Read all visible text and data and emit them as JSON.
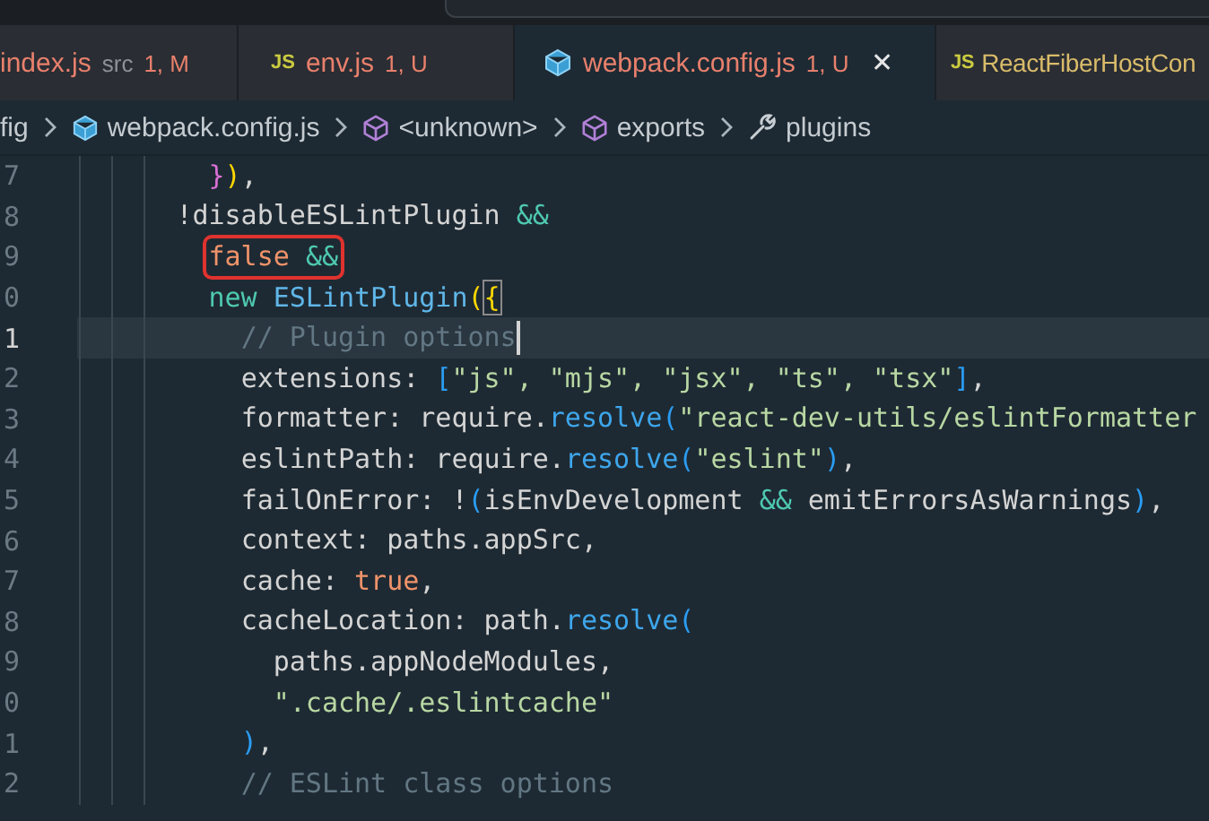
{
  "tabs": [
    {
      "label": "index.js",
      "description": "src",
      "status": "1, M",
      "kind": "plain",
      "color": "#e8806c",
      "selected": false
    },
    {
      "label": "env.js",
      "status": "1, U",
      "kind": "js",
      "icon_text": "JS",
      "color": "#e8806c",
      "selected": false
    },
    {
      "label": "webpack.config.js",
      "status": "1, U",
      "kind": "cube",
      "color": "#e8806c",
      "selected": true,
      "close": "✕"
    },
    {
      "label": "ReactFiberHostCon",
      "kind": "js",
      "icon_text": "JS",
      "color": "#d9bb6a",
      "selected": false
    }
  ],
  "breadcrumbs": [
    {
      "label": "fig",
      "kind": "folder"
    },
    {
      "label": "webpack.config.js",
      "kind": "file"
    },
    {
      "label": "<unknown>",
      "kind": "symbol"
    },
    {
      "label": "exports",
      "kind": "symbol"
    },
    {
      "label": "plugins",
      "kind": "property"
    }
  ],
  "lines": [
    {
      "number": "7",
      "current": false,
      "boxed": false,
      "tokens": [
        {
          "text": "        }",
          "kind": "bracket2"
        },
        {
          "text": ")",
          "kind": "bracket1"
        },
        {
          "text": ",",
          "kind": "plain"
        }
      ]
    },
    {
      "number": "8",
      "current": false,
      "boxed": false,
      "tokens": [
        {
          "text": "      !disableESLintPlugin ",
          "kind": "plain"
        },
        {
          "text": "&&",
          "kind": "operator"
        }
      ]
    },
    {
      "number": "9",
      "current": false,
      "boxed": true,
      "tokens": [
        {
          "text": "        false ",
          "kind": "constant"
        },
        {
          "text": "&&",
          "kind": "operator"
        }
      ]
    },
    {
      "number": "0",
      "current": false,
      "boxed": false,
      "tokens": [
        {
          "text": "        new ",
          "kind": "operator"
        },
        {
          "text": "ESLintPlugin",
          "kind": "class"
        },
        {
          "text": "(",
          "kind": "bracket1"
        },
        {
          "text": "{",
          "kind": "bracket-match"
        }
      ]
    },
    {
      "number": "1",
      "current": true,
      "boxed": false,
      "tokens": [
        {
          "text": "          // Plugin options",
          "kind": "comment"
        }
      ]
    },
    {
      "number": "2",
      "current": false,
      "boxed": false,
      "tokens": [
        {
          "text": "          extensions: ",
          "kind": "plain"
        },
        {
          "text": "[",
          "kind": "bracket3"
        },
        {
          "text": "\"js\", \"mjs\", \"jsx\", \"ts\", \"tsx\"",
          "kind": "string"
        },
        {
          "text": "]",
          "kind": "bracket3"
        },
        {
          "text": ",",
          "kind": "plain"
        }
      ]
    },
    {
      "number": "3",
      "current": false,
      "boxed": false,
      "tokens": [
        {
          "text": "          formatter: require.",
          "kind": "plain"
        },
        {
          "text": "resolve",
          "kind": "function"
        },
        {
          "text": "(",
          "kind": "bracket3"
        },
        {
          "text": "\"react-dev-utils/eslintFormatter",
          "kind": "string"
        }
      ]
    },
    {
      "number": "4",
      "current": false,
      "boxed": false,
      "tokens": [
        {
          "text": "          eslintPath: require.",
          "kind": "plain"
        },
        {
          "text": "resolve",
          "kind": "function"
        },
        {
          "text": "(",
          "kind": "bracket3"
        },
        {
          "text": "\"eslint\"",
          "kind": "string"
        },
        {
          "text": ")",
          "kind": "bracket3"
        },
        {
          "text": ",",
          "kind": "plain"
        }
      ]
    },
    {
      "number": "5",
      "current": false,
      "boxed": false,
      "tokens": [
        {
          "text": "          failOnError: !",
          "kind": "plain"
        },
        {
          "text": "(",
          "kind": "bracket3"
        },
        {
          "text": "isEnvDevelopment ",
          "kind": "plain"
        },
        {
          "text": "&&",
          "kind": "operator"
        },
        {
          "text": " emitErrorsAsWarnings",
          "kind": "plain"
        },
        {
          "text": ")",
          "kind": "bracket3"
        },
        {
          "text": ",",
          "kind": "plain"
        }
      ]
    },
    {
      "number": "6",
      "current": false,
      "boxed": false,
      "tokens": [
        {
          "text": "          context: paths.appSrc,",
          "kind": "plain"
        }
      ]
    },
    {
      "number": "7",
      "current": false,
      "boxed": false,
      "tokens": [
        {
          "text": "          cache: ",
          "kind": "plain"
        },
        {
          "text": "true",
          "kind": "constant"
        },
        {
          "text": ",",
          "kind": "plain"
        }
      ]
    },
    {
      "number": "8",
      "current": false,
      "boxed": false,
      "tokens": [
        {
          "text": "          cacheLocation: path.",
          "kind": "plain"
        },
        {
          "text": "resolve",
          "kind": "function"
        },
        {
          "text": "(",
          "kind": "bracket3"
        }
      ]
    },
    {
      "number": "9",
      "current": false,
      "boxed": false,
      "tokens": [
        {
          "text": "            paths.appNodeModules,",
          "kind": "plain"
        }
      ]
    },
    {
      "number": "0",
      "current": false,
      "boxed": false,
      "tokens": [
        {
          "text": "            \".cache/.eslintcache\"",
          "kind": "string"
        }
      ]
    },
    {
      "number": "1",
      "current": false,
      "boxed": false,
      "tokens": [
        {
          "text": "          )",
          "kind": "bracket3"
        },
        {
          "text": ",",
          "kind": "plain"
        }
      ]
    },
    {
      "number": "2",
      "current": false,
      "boxed": false,
      "tokens": [
        {
          "text": "          // ESLint class options",
          "kind": "comment"
        }
      ]
    }
  ]
}
